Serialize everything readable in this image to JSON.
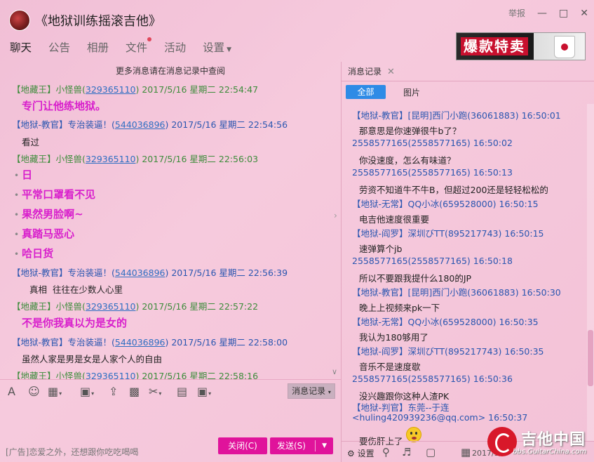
{
  "window": {
    "title": "《地狱训练摇滚吉他》",
    "report": "举报"
  },
  "nav": {
    "tabs": [
      {
        "label": "聊天"
      },
      {
        "label": "公告"
      },
      {
        "label": "相册"
      },
      {
        "label": "文件"
      },
      {
        "label": "活动"
      },
      {
        "label": "设置"
      }
    ]
  },
  "ad_banner": {
    "text": "爆款特卖"
  },
  "chat": {
    "more_notice": "更多消息请在消息记录中查阅",
    "messages": [
      {
        "role": "【地藏王】",
        "name": "小怪兽",
        "qq": "329365110",
        "time": "2017/5/16 星期二 22:54:47",
        "lines": [
          "专门让他练地狱。"
        ]
      },
      {
        "role": "【地狱-教官】",
        "name": "专治装逼！",
        "qq": "544036896",
        "time": "2017/5/16 星期二 22:54:56",
        "lines": [
          "看过"
        ]
      },
      {
        "role": "【地藏王】",
        "name": "小怪兽",
        "qq": "329365110",
        "time": "2017/5/16 星期二 22:56:03",
        "lines": [
          "日",
          "平常口罩看不见",
          "果然男脸啊~",
          "真踏马恶心",
          "哈日货"
        ]
      },
      {
        "role": "【地狱-教官】",
        "name": "专治装逼！",
        "qq": "544036896",
        "time": "2017/5/16 星期二 22:56:39",
        "lines": [
          "真相  往往在少数人心里"
        ]
      },
      {
        "role": "【地藏王】",
        "name": "小怪兽",
        "qq": "329365110",
        "time": "2017/5/16 星期二 22:57:22",
        "lines": [
          "不是你我真以为是女的"
        ]
      },
      {
        "role": "【地狱-教官】",
        "name": "专治装逼！",
        "qq": "544036896",
        "time": "2017/5/16 星期二 22:58:00",
        "lines": [
          "虽然人家是男是女是人家个人的自由"
        ]
      },
      {
        "role": "【地藏王】",
        "name": "小怪兽",
        "qq": "329365110",
        "time": "2017/5/16 星期二 22:58:16",
        "lines": []
      }
    ]
  },
  "toolbar": {
    "history_label": "消息记录"
  },
  "bottom": {
    "ad_text": "[广告]恋爱之外，还想跟你吃吃喝喝",
    "close_label": "关闭(C)",
    "send_label": "发送(S)"
  },
  "history": {
    "tab_label": "消息记录",
    "filter_all": "全部",
    "filter_images": "图片",
    "entries": [
      {
        "header": "【地狱-教官】[昆明]西门小跑(36061883) 16:50:01",
        "text": "那意思是你速弹很牛b了？"
      },
      {
        "header": "2558577165(2558577165) 16:50:02",
        "text": "你没速度，怎么有味道？"
      },
      {
        "header": "2558577165(2558577165) 16:50:13",
        "text": "劳资不知道牛不牛B，但超过200还是轻轻松松的"
      },
      {
        "header": "【地狱-无常】QQ小冰(659528000) 16:50:15",
        "text": "电吉他速度很重要"
      },
      {
        "header": "【地狱-阎罗】深圳びTT(895217743) 16:50:15",
        "text": "速弹算个jb"
      },
      {
        "header": "2558577165(2558577165) 16:50:18",
        "text": "所以不要跟我提什么180的JP"
      },
      {
        "header": "【地狱-教官】[昆明]西门小跑(36061883) 16:50:30",
        "text": "晚上上视频来pk一下"
      },
      {
        "header": "【地狱-无常】QQ小冰(659528000) 16:50:35",
        "text": "我认为180够用了"
      },
      {
        "header": "【地狱-阎罗】深圳びTT(895217743) 16:50:35",
        "text": "音乐不是速度歇"
      },
      {
        "header": "2558577165(2558577165) 16:50:36",
        "text": "没兴趣跟你这种人渣PK"
      },
      {
        "header": "【地狱-判官】东莞--于连<huling420939236@qq.com> 16:50:37",
        "text": "要伤肝上了"
      }
    ],
    "settings_label": "设置",
    "date_partial": "2017/5/1"
  },
  "watermark": {
    "title": "吉他中国",
    "url": "bbs.GuitarChina.com"
  }
}
